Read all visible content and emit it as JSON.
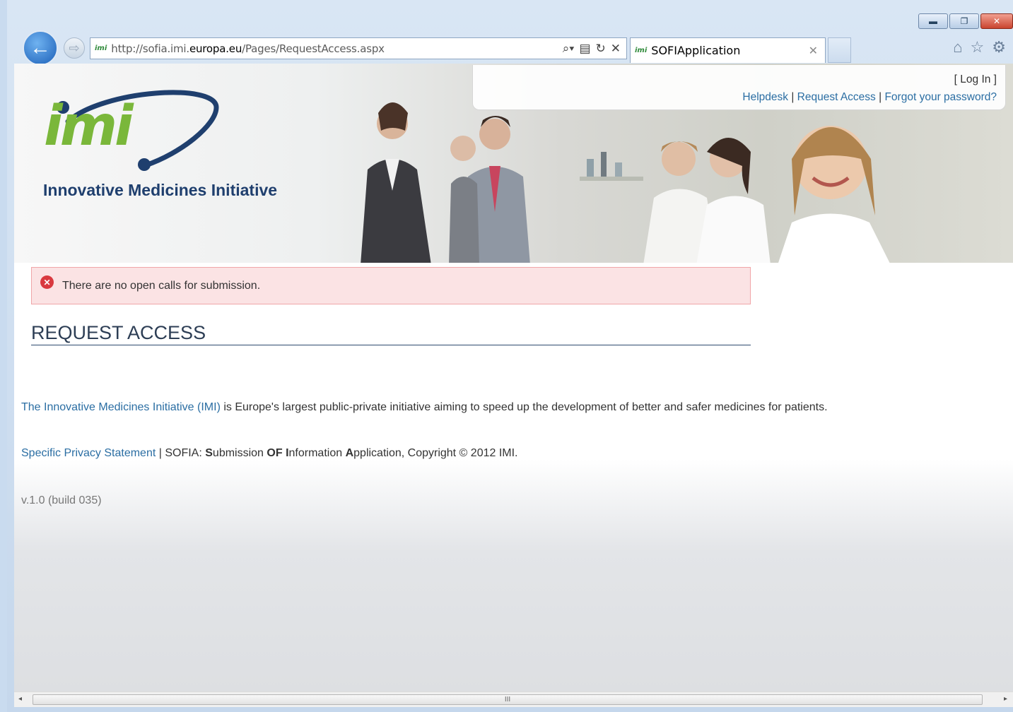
{
  "browser": {
    "address_host_prefix": "http://sofia.imi.",
    "address_host_bold": "europa.eu",
    "address_path": "/Pages/RequestAccess.aspx",
    "tab_title": "SOFIApplication",
    "favicon_text": "imi"
  },
  "header": {
    "logo_text": "imi",
    "logo_tagline": "Innovative Medicines Initiative",
    "login_link": "[ Log In ]",
    "links": [
      "Helpdesk",
      "Request Access",
      "Forgot your password?"
    ],
    "separator": "|"
  },
  "alert": {
    "message": "There are no open calls for submission."
  },
  "page": {
    "title": "REQUEST ACCESS",
    "intro_link": "The Innovative Medicines Initiative (IMI)",
    "intro_text": " is Europe's largest public-private initiative aiming to speed up the development of better and safer medicines for patients.",
    "privacy_link": "Specific Privacy Statement",
    "footer_sep": " | SOFIA: ",
    "footer_s": "S",
    "footer_ubmission": "ubmission ",
    "footer_of": "OF",
    "footer_i_space": " ",
    "footer_i": "I",
    "footer_nformation": "nformation ",
    "footer_a": "A",
    "footer_pplication": "pplication, Copyright © 2012 IMI.",
    "version": "v.1.0 (build 035)"
  },
  "colors": {
    "link": "#2b6ea3",
    "logo_green": "#7ab73a",
    "logo_navy": "#1f3f6e",
    "error_bg": "#fbe3e4",
    "error_border": "#f0a6a8"
  },
  "icons": [
    "back-arrow-icon",
    "forward-arrow-icon",
    "search-icon",
    "compat-icon",
    "refresh-icon",
    "stop-icon",
    "home-icon",
    "favorites-star-icon",
    "gear-icon",
    "error-icon"
  ]
}
